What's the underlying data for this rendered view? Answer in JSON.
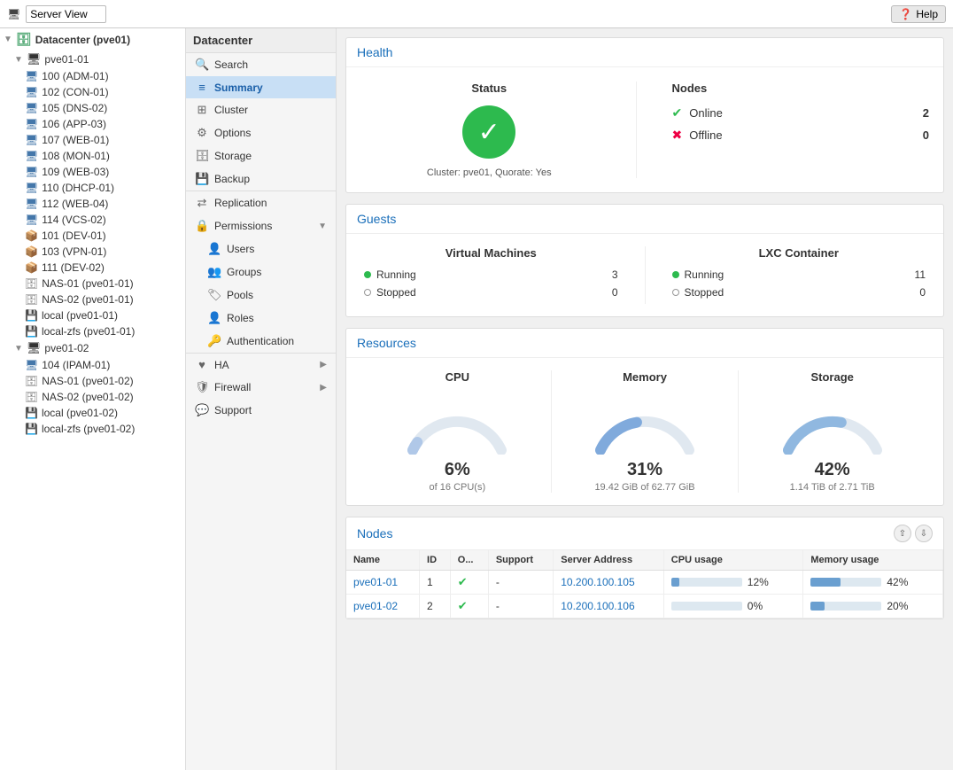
{
  "topbar": {
    "title": "Server View",
    "help_label": "Help"
  },
  "header": {
    "datacenter_label": "Datacenter"
  },
  "tree": {
    "root": "Datacenter (pve01)",
    "nodes": [
      {
        "label": "pve01-01",
        "type": "node",
        "children": [
          {
            "label": "100 (ADM-01)",
            "type": "vm"
          },
          {
            "label": "102 (CON-01)",
            "type": "vm"
          },
          {
            "label": "105 (DNS-02)",
            "type": "vm"
          },
          {
            "label": "106 (APP-03)",
            "type": "vm"
          },
          {
            "label": "107 (WEB-01)",
            "type": "vm"
          },
          {
            "label": "108 (MON-01)",
            "type": "vm"
          },
          {
            "label": "109 (WEB-03)",
            "type": "vm"
          },
          {
            "label": "110 (DHCP-01)",
            "type": "vm"
          },
          {
            "label": "112 (WEB-04)",
            "type": "vm"
          },
          {
            "label": "114 (VCS-02)",
            "type": "vm"
          },
          {
            "label": "101 (DEV-01)",
            "type": "ct"
          },
          {
            "label": "103 (VPN-01)",
            "type": "ct"
          },
          {
            "label": "111 (DEV-02)",
            "type": "ct"
          },
          {
            "label": "NAS-01 (pve01-01)",
            "type": "stor"
          },
          {
            "label": "NAS-02 (pve01-01)",
            "type": "stor"
          },
          {
            "label": "local (pve01-01)",
            "type": "stor"
          },
          {
            "label": "local-zfs (pve01-01)",
            "type": "stor"
          }
        ]
      },
      {
        "label": "pve01-02",
        "type": "node",
        "children": [
          {
            "label": "104 (IPAM-01)",
            "type": "vm"
          },
          {
            "label": "NAS-01 (pve01-02)",
            "type": "stor"
          },
          {
            "label": "NAS-02 (pve01-02)",
            "type": "stor"
          },
          {
            "label": "local (pve01-02)",
            "type": "stor"
          },
          {
            "label": "local-zfs (pve01-02)",
            "type": "stor"
          }
        ]
      }
    ]
  },
  "nav": {
    "items": [
      {
        "label": "Search",
        "icon": "🔍",
        "id": "search"
      },
      {
        "label": "Summary",
        "icon": "≡",
        "id": "summary",
        "active": true
      },
      {
        "label": "Cluster",
        "icon": "⊞",
        "id": "cluster"
      },
      {
        "label": "Options",
        "icon": "⚙",
        "id": "options"
      },
      {
        "label": "Storage",
        "icon": "🗄",
        "id": "storage"
      },
      {
        "label": "Backup",
        "icon": "💾",
        "id": "backup"
      },
      {
        "label": "Replication",
        "icon": "⊞",
        "id": "replication"
      },
      {
        "label": "Permissions",
        "icon": "🔒",
        "id": "permissions"
      },
      {
        "label": "Users",
        "icon": "👤",
        "id": "users",
        "indent": true
      },
      {
        "label": "Groups",
        "icon": "👥",
        "id": "groups",
        "indent": true
      },
      {
        "label": "Pools",
        "icon": "🏷",
        "id": "pools",
        "indent": true
      },
      {
        "label": "Roles",
        "icon": "👤",
        "id": "roles",
        "indent": true
      },
      {
        "label": "Authentication",
        "icon": "🔑",
        "id": "authentication",
        "indent": true
      },
      {
        "label": "HA",
        "icon": "♥",
        "id": "ha"
      },
      {
        "label": "Firewall",
        "icon": "🛡",
        "id": "firewall"
      },
      {
        "label": "Support",
        "icon": "💬",
        "id": "support"
      }
    ]
  },
  "health": {
    "section_title": "Health",
    "status_title": "Status",
    "nodes_title": "Nodes",
    "cluster_info": "Cluster: pve01, Quorate: Yes",
    "online_label": "Online",
    "online_count": "2",
    "offline_label": "Offline",
    "offline_count": "0"
  },
  "guests": {
    "section_title": "Guests",
    "vm_title": "Virtual Machines",
    "lxc_title": "LXC Container",
    "vm_running_label": "Running",
    "vm_running_count": "3",
    "vm_stopped_label": "Stopped",
    "vm_stopped_count": "0",
    "lxc_running_label": "Running",
    "lxc_running_count": "11",
    "lxc_stopped_label": "Stopped",
    "lxc_stopped_count": "0"
  },
  "resources": {
    "section_title": "Resources",
    "cpu_title": "CPU",
    "cpu_percent": "6%",
    "cpu_sub": "of 16 CPU(s)",
    "cpu_value": 6,
    "mem_title": "Memory",
    "mem_percent": "31%",
    "mem_sub": "19.42 GiB of 62.77 GiB",
    "mem_value": 31,
    "stor_title": "Storage",
    "stor_percent": "42%",
    "stor_sub": "1.14 TiB of 2.71 TiB",
    "stor_value": 42
  },
  "nodes_table": {
    "section_title": "Nodes",
    "columns": [
      "Name",
      "ID",
      "O...",
      "Support",
      "Server Address",
      "CPU usage",
      "Memory usage"
    ],
    "rows": [
      {
        "name": "pve01-01",
        "id": "1",
        "online": true,
        "support": "-",
        "address": "10.200.100.105",
        "cpu_percent": "12%",
        "cpu_bar": 12,
        "mem_percent": "42%",
        "mem_bar": 42
      },
      {
        "name": "pve01-02",
        "id": "2",
        "online": true,
        "support": "-",
        "address": "10.200.100.106",
        "cpu_percent": "0%",
        "cpu_bar": 0,
        "mem_percent": "20%",
        "mem_bar": 20
      }
    ]
  }
}
